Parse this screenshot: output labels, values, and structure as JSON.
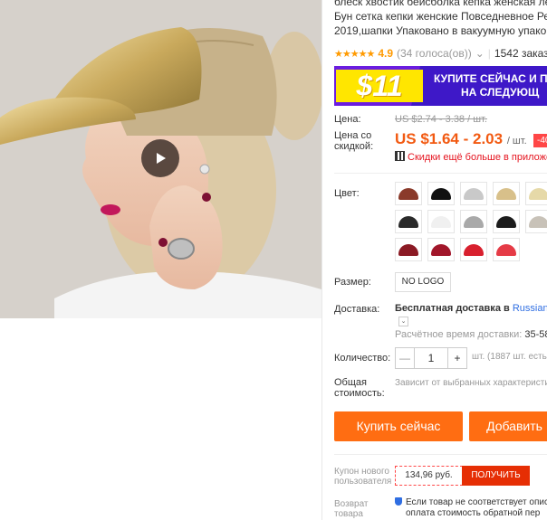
{
  "product": {
    "title_lines": [
      "блеск хвостик бейсболка кепка женская ле",
      "Бун сетка кепки женские Повседневное Ре",
      "2019,шапки Упаковано в вакуумную упако"
    ],
    "rating": "4.9",
    "votes": "(34 голоса(ов))",
    "orders": "1542 заказа(ов"
  },
  "banner": {
    "price": "$11",
    "line1": "КУПИТЕ СЕЙЧАС И ПО",
    "line2": "НА СЛЕДУЮЩ"
  },
  "price": {
    "label": "Цена:",
    "old": "US $2.74 - 3.38 / шт.",
    "discount_label": "Цена со скидкой:",
    "current": "US $1.64 - 2.03",
    "unit": "/ шт.",
    "badge": "-40",
    "app_link": "Скидки ещё больше в приложени"
  },
  "options": {
    "color_label": "Цвет:",
    "size_label": "Размер:",
    "size_value": "NO LOGO"
  },
  "swatch_colors": [
    "#8a3a2a",
    "#111111",
    "#c9c9c9",
    "#d8c08a",
    "#e6d9a8",
    "#2a2a2a",
    "#f0f0f0",
    "#a9a9a9",
    "#1c1c1c",
    "#c8c2b8",
    "#8b1a24",
    "#a1162a",
    "#d8202e",
    "#e53b46"
  ],
  "shipping": {
    "label": "Доставка:",
    "text": "Бесплатная доставка в",
    "dest": "Russian Fed",
    "eta_label": "Расчётное время доставки:",
    "eta_value": "35-58 дн"
  },
  "quantity": {
    "label": "Количество:",
    "value": "1",
    "available": "шт. (1887 шт. есть",
    "total_label": "Общая стоимость:",
    "total_note": "Зависит от выбранных характеристи"
  },
  "actions": {
    "buy": "Купить сейчас",
    "cart": "Добавить"
  },
  "coupon": {
    "label": "Купон нового пользователя",
    "amount": "134,96 руб.",
    "get": "ПОЛУЧИТЬ"
  },
  "returns": {
    "label": "Возврат товара",
    "line1": "Если товар не соответствует опис",
    "line2": "оплата стоимость обратной пер"
  }
}
